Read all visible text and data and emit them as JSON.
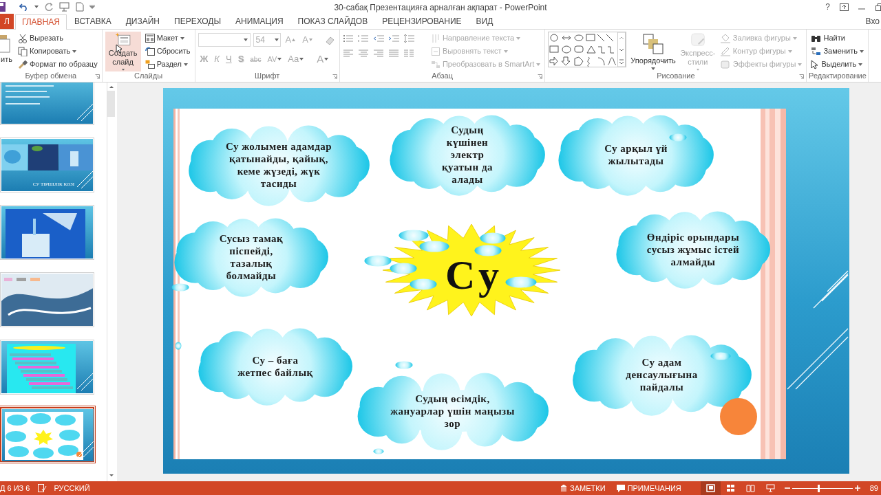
{
  "title_bar": {
    "title": "30-сабақ Презентацияға арналған ақпарат - PowerPoint",
    "help": "?",
    "account": "Вхо"
  },
  "tabs": [
    {
      "label": "Л",
      "kind": "file",
      "selected": false
    },
    {
      "label": "ГЛАВНАЯ",
      "kind": "tab",
      "selected": true
    },
    {
      "label": "ВСТАВКА",
      "kind": "tab",
      "selected": false
    },
    {
      "label": "ДИЗАЙН",
      "kind": "tab",
      "selected": false
    },
    {
      "label": "ПЕРЕХОДЫ",
      "kind": "tab",
      "selected": false
    },
    {
      "label": "АНИМАЦИЯ",
      "kind": "tab",
      "selected": false
    },
    {
      "label": "ПОКАЗ СЛАЙДОВ",
      "kind": "tab",
      "selected": false
    },
    {
      "label": "РЕЦЕНЗИРОВАНИЕ",
      "kind": "tab",
      "selected": false
    },
    {
      "label": "ВИД",
      "kind": "tab",
      "selected": false
    }
  ],
  "ribbon": [
    {
      "kind": "clipboard",
      "label": "Буфер обмена",
      "launcher": true,
      "controls": [
        {
          "kind": "paste",
          "label": "ить"
        },
        {
          "kind": "cut",
          "label": "Вырезать"
        },
        {
          "kind": "copy",
          "label": "Копировать",
          "menu": true
        },
        {
          "kind": "format",
          "label": "Формат по образцу"
        }
      ]
    },
    {
      "kind": "slides",
      "label": "Слайды",
      "controls": [
        {
          "kind": "new_slide",
          "label": "Создать слайд",
          "menu": true,
          "highlighted": true
        },
        {
          "kind": "layout",
          "label": "Макет",
          "menu": true
        },
        {
          "kind": "reset",
          "label": "Сбросить"
        },
        {
          "kind": "section",
          "label": "Раздел",
          "menu": true
        }
      ]
    },
    {
      "kind": "font",
      "label": "Шрифт",
      "launcher": true,
      "disabled": true,
      "font_size": "54",
      "size_buttons": [
        "A",
        "A"
      ],
      "format_buttons": [
        {
          "label": "Ж"
        },
        {
          "label": "К"
        },
        {
          "label": "Ч"
        },
        {
          "label": "S"
        },
        {
          "label": "abc"
        },
        {
          "label": "AV",
          "menu": true
        },
        {
          "label": "Aa",
          "menu": true
        },
        {
          "label": "A",
          "menu": true
        }
      ]
    },
    {
      "kind": "paragraph",
      "label": "Абзац",
      "launcher": true,
      "controls": [
        {
          "kind": "text_direction",
          "label": "Направление текста",
          "menu": true,
          "disabled": true
        },
        {
          "kind": "align_text",
          "label": "Выровнять текст",
          "menu": true,
          "disabled": true
        },
        {
          "kind": "smartart",
          "label": "Преобразовать в SmartArt",
          "menu": true,
          "disabled": true
        }
      ]
    },
    {
      "kind": "drawing",
      "label": "Рисование",
      "launcher": true,
      "controls": [
        {
          "kind": "arrange",
          "label": "Упорядочить",
          "menu": true
        },
        {
          "kind": "styles",
          "label": "Экспресс-стили",
          "menu": true,
          "disabled": true
        },
        {
          "kind": "fill",
          "label": "Заливка фигуры",
          "menu": true,
          "disabled": true
        },
        {
          "kind": "outline",
          "label": "Контур фигуры",
          "menu": true,
          "disabled": true
        },
        {
          "kind": "effects",
          "label": "Эффекты фигуры",
          "menu": true,
          "disabled": true
        }
      ]
    },
    {
      "kind": "editing",
      "label": "Редактирование",
      "controls": [
        {
          "kind": "find",
          "label": "Найти"
        },
        {
          "kind": "replace",
          "label": "Заменить",
          "menu": true
        },
        {
          "kind": "select",
          "label": "Выделить",
          "menu": true
        }
      ]
    }
  ],
  "thumbnails": [
    {
      "selected": false
    },
    {
      "selected": false,
      "caption": "СУ ТІРШІЛІК КӨЗІ"
    },
    {
      "selected": false
    },
    {
      "selected": false
    },
    {
      "selected": false
    },
    {
      "selected": true
    }
  ],
  "slide": {
    "center_text": "Су",
    "clouds": [
      {
        "text": "Су жолымен адамдар қатынайды, қайық, кеме жүзеді, жүк тасиды"
      },
      {
        "text": "Судың күшінен электр қуатын да алады"
      },
      {
        "text": "Су арқыл үй жылытады"
      },
      {
        "text": "Сусыз тамақ піспейді, тазалық болмайды"
      },
      {
        "text": "Өндіріс орындары сусыз жұмыс істей алмайды"
      },
      {
        "text": "Су – баға жетпес байлық"
      },
      {
        "text": "Судың өсімдік, жануарлар үшін маңызы зор"
      },
      {
        "text": "Су адам денсаулығына пайдалы"
      }
    ]
  },
  "status_bar": {
    "slide_counter": "Д 6 ИЗ 6",
    "language": "РУССКИЙ",
    "notes": "ЗАМЕТКИ",
    "comments": "ПРИМЕЧАНИЯ",
    "views": [
      {
        "selected": true
      },
      {
        "selected": false
      },
      {
        "selected": false
      },
      {
        "selected": false
      }
    ],
    "zoom": {
      "level": 0.43,
      "reading": "89"
    }
  }
}
